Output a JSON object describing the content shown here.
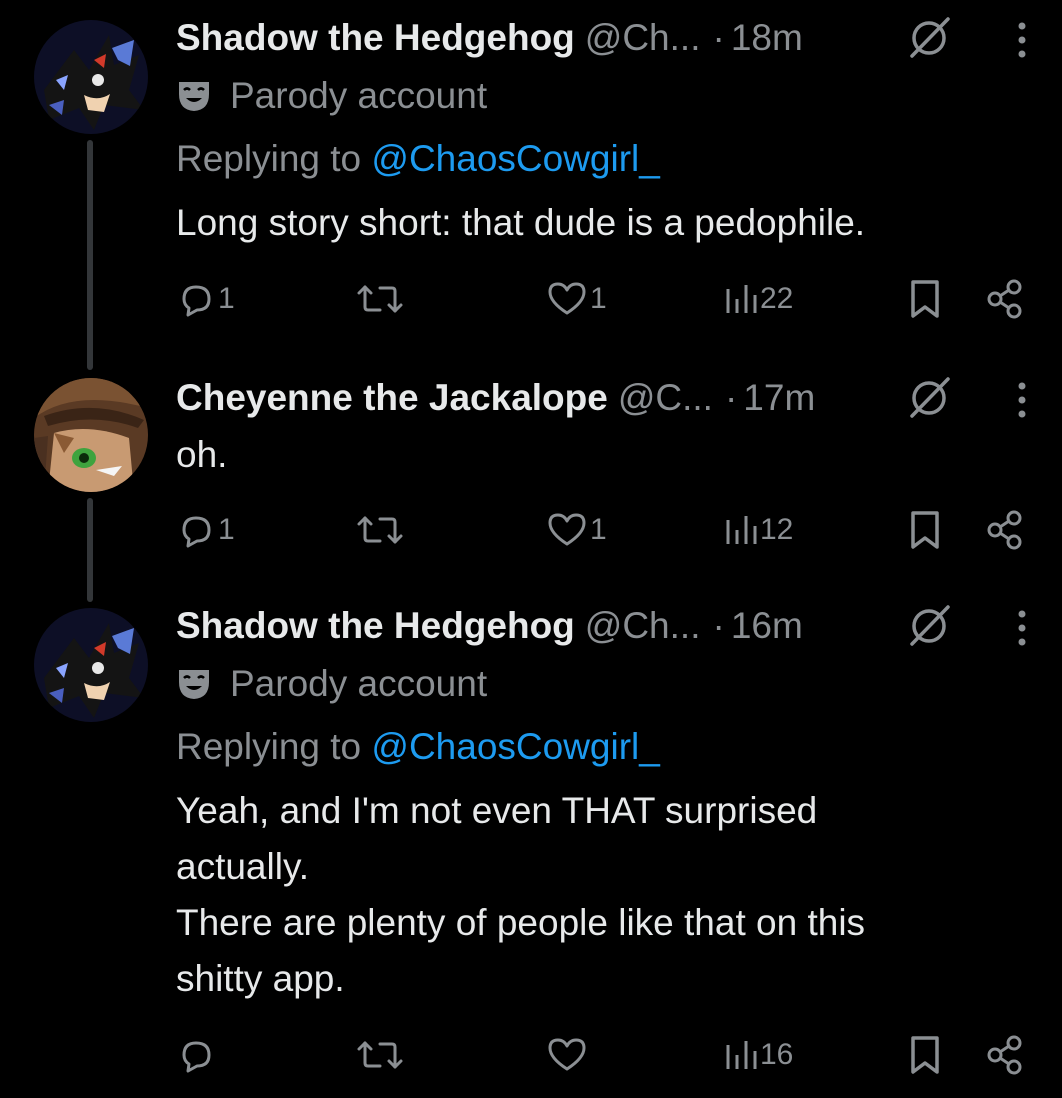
{
  "posts": [
    {
      "author": "Shadow the Hedgehog",
      "handle": "@Ch...",
      "time": "18m",
      "badge": "Parody account",
      "reply_prefix": "Replying to",
      "reply_handle": "@ChaosCowgirl_",
      "text_lines": [
        "Long story short: that dude is a pedophile."
      ],
      "replies": "1",
      "likes": "1",
      "views": "22"
    },
    {
      "author": "Cheyenne the Jackalope",
      "handle": "@C...",
      "time": "17m",
      "text_lines": [
        "oh."
      ],
      "replies": "1",
      "likes": "1",
      "views": "12"
    },
    {
      "author": "Shadow the Hedgehog",
      "handle": "@Ch...",
      "time": "16m",
      "badge": "Parody account",
      "reply_prefix": "Replying to",
      "reply_handle": "@ChaosCowgirl_",
      "text_lines": [
        "Yeah, and I'm not even THAT surprised",
        "actually.",
        "There are plenty of people like that on this",
        "shitty app."
      ],
      "replies": "",
      "likes": "",
      "views": "16"
    }
  ],
  "separator": "·",
  "colors": {
    "background": "#000000",
    "text": "#e7e9ea",
    "muted": "#8b8f93",
    "link": "#1d9bf0",
    "thread_line": "#333639"
  },
  "icons": [
    "reply-icon",
    "retweet-icon",
    "like-icon",
    "views-icon",
    "bookmark-icon",
    "share-icon",
    "grok-icon",
    "more-icon",
    "parody-mask-icon"
  ]
}
